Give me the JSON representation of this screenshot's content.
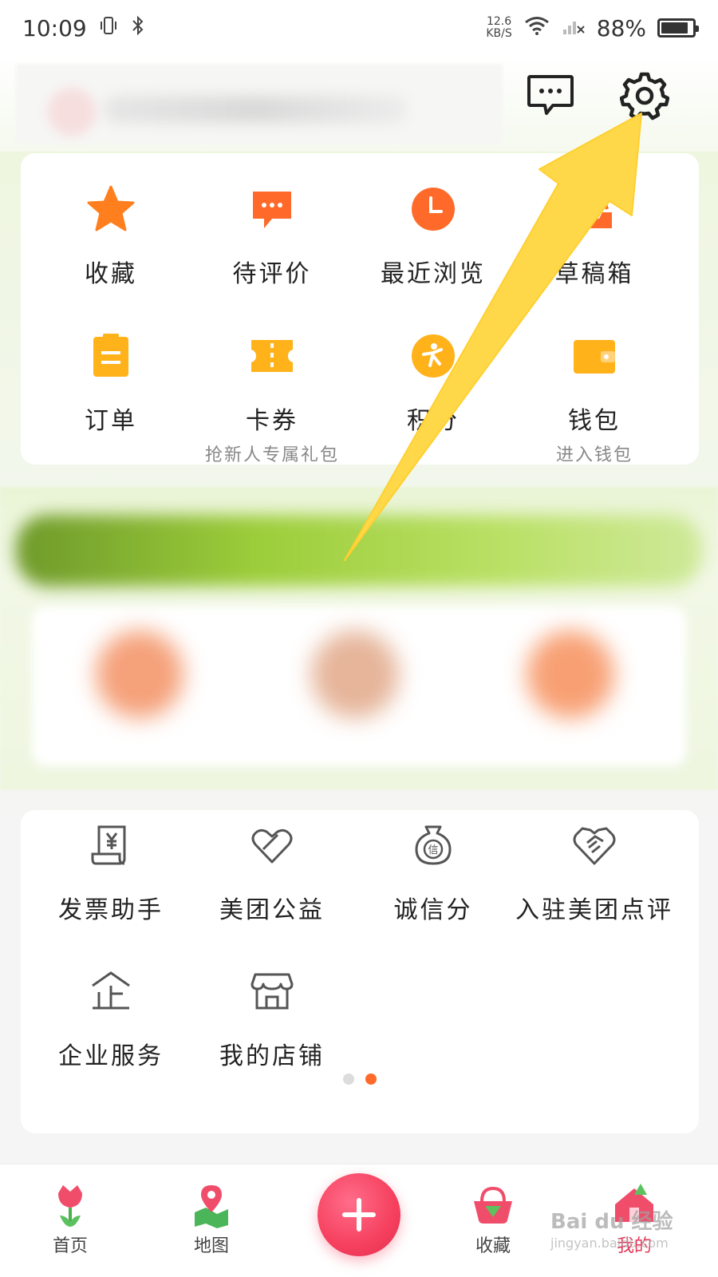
{
  "status_bar": {
    "time": "10:09",
    "net_speed_value": "12.6",
    "net_speed_unit": "KB/S",
    "battery": "88%",
    "battery_level": 0.88
  },
  "header": {
    "message_icon": "message-icon",
    "settings_icon": "gear-icon"
  },
  "shortcuts": [
    {
      "label": "收藏",
      "icon": "star-icon",
      "color": "#ff7a1a"
    },
    {
      "label": "待评价",
      "icon": "comment-icon",
      "color": "#ff6a2a"
    },
    {
      "label": "最近浏览",
      "icon": "clock-icon",
      "color": "#ff6a2a"
    },
    {
      "label": "草稿箱",
      "icon": "draft-icon",
      "color": "#ff6a2a"
    },
    {
      "label": "订单",
      "icon": "order-icon",
      "color": "#ffb21a"
    },
    {
      "label": "卡券",
      "sub": "抢新人专属礼包",
      "icon": "ticket-icon",
      "color": "#ffb21a"
    },
    {
      "label": "积分",
      "icon": "points-icon",
      "color": "#ffb21a"
    },
    {
      "label": "钱包",
      "sub": "进入钱包",
      "icon": "wallet-icon",
      "color": "#ffb21a"
    }
  ],
  "services": [
    {
      "label": "发票助手",
      "icon": "invoice-icon"
    },
    {
      "label": "美团公益",
      "icon": "charity-icon"
    },
    {
      "label": "诚信分",
      "icon": "credit-icon"
    },
    {
      "label": "入驻美团点评",
      "icon": "handshake-icon"
    },
    {
      "label": "企业服务",
      "icon": "enterprise-icon"
    },
    {
      "label": "我的店铺",
      "icon": "shop-icon"
    }
  ],
  "pager": {
    "total": 2,
    "active": 2
  },
  "bottom_nav": [
    {
      "label": "首页",
      "icon": "tulip-icon"
    },
    {
      "label": "地图",
      "icon": "map-pin-icon"
    },
    {
      "label": "收藏",
      "icon": "basket-icon"
    },
    {
      "label": "我的",
      "icon": "house-icon",
      "active": true
    }
  ],
  "watermark": {
    "brand": "Bai du 经验",
    "url": "jingyan.baidu.com"
  },
  "colors": {
    "accent": "#ff6a2a",
    "arrow": "#ffd84a",
    "plus": "#f5405e"
  }
}
